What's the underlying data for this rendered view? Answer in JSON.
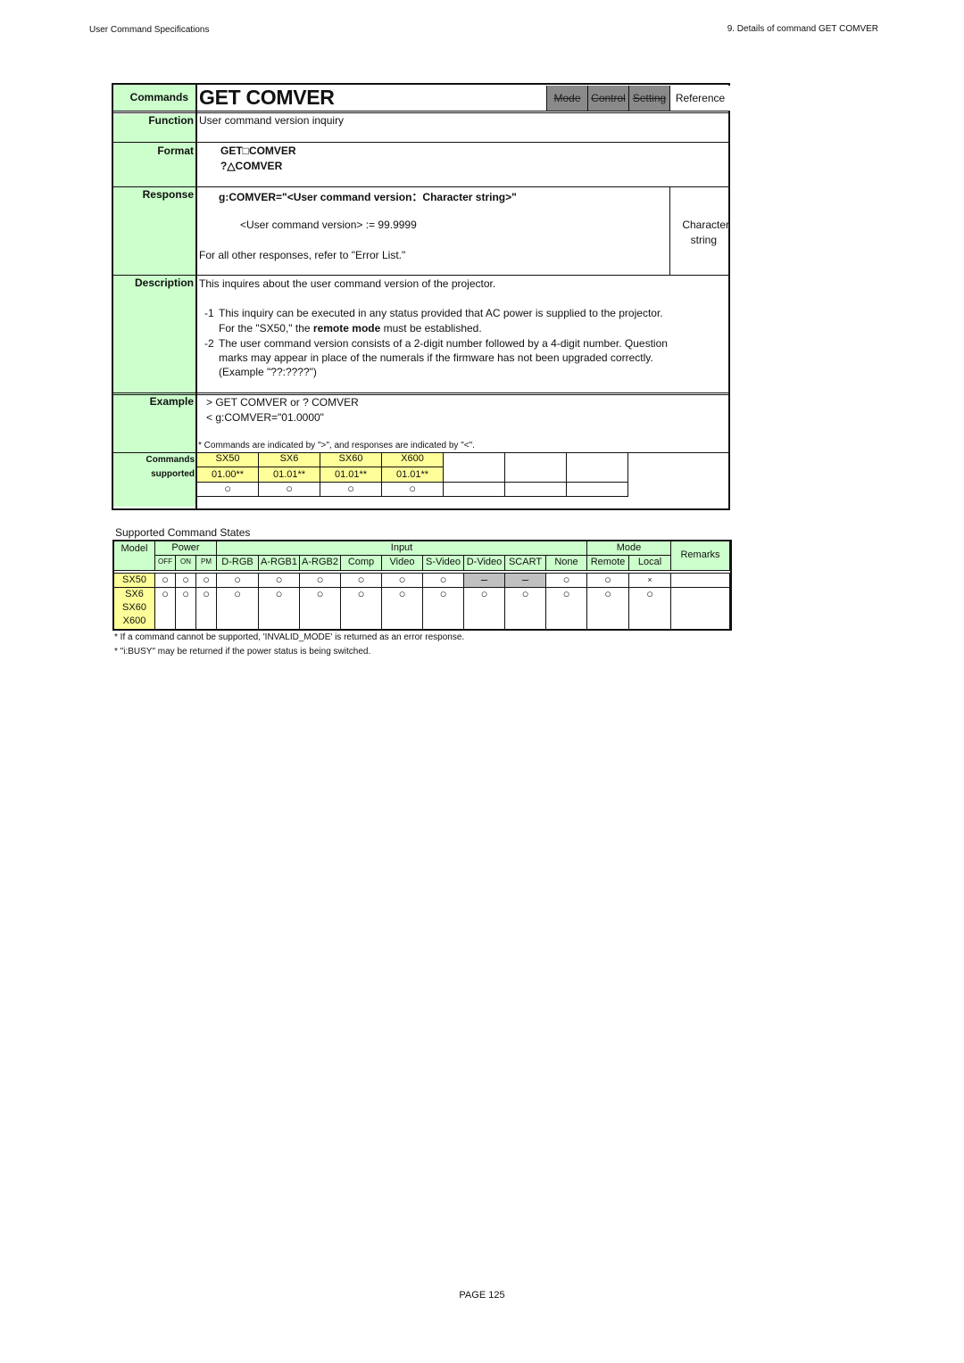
{
  "page_header": {
    "left": "User Command Specifications",
    "right": "9. Details of command  GET COMVER"
  },
  "spec": {
    "commands_label": "Commands",
    "command_name": "GET COMVER",
    "tabs": [
      {
        "label": "Mode",
        "enabled": false
      },
      {
        "label": "Control",
        "enabled": false
      },
      {
        "label": "Setting",
        "enabled": false
      },
      {
        "label": "Reference",
        "enabled": true
      }
    ],
    "function_label": "Function",
    "function_text": "User command version inquiry",
    "format_label": "Format",
    "format_lines": [
      "GET□COMVER",
      "?△COMVER"
    ],
    "response_label": "Response",
    "response_format": "g:COMVER=\"<User command version：Character string>\"",
    "response_def": "<User command version> := 99.9999",
    "response_type": [
      "Character",
      "string"
    ],
    "response_other": "For all other responses, refer to \"Error List.\"",
    "description_label": "Description",
    "description_intro": "This inquires about the user command version of the projector.",
    "description_items": [
      {
        "num": "-1",
        "lines": [
          "This inquiry can be executed in any status provided that AC power is supplied to the projector.",
          "For the \"SX50,\" the ",
          "remote mode",
          " must be established."
        ]
      },
      {
        "num": "-2",
        "lines": [
          "The user command version consists of a 2-digit number followed by a 4-digit number. Question",
          "marks may appear in place of the numerals if the firmware has not been upgraded correctly.",
          "(Example \"??:????\")"
        ]
      }
    ],
    "example_label": "Example",
    "example_lines": [
      ">  GET COMVER or ? COMVER",
      "<  g:COMVER=\"01.0000\""
    ],
    "example_note": "* Commands are indicated by \">\", and responses are indicated by \"<\".",
    "supported_label": [
      "Commands",
      "supported"
    ],
    "supported_models": [
      {
        "model": "SX50",
        "version": "01.00**",
        "mark": "○"
      },
      {
        "model": "SX6",
        "version": "01.01**",
        "mark": "○"
      },
      {
        "model": "SX60",
        "version": "01.01**",
        "mark": "○"
      },
      {
        "model": "X600",
        "version": "01.01**",
        "mark": "○"
      }
    ]
  },
  "states": {
    "title": "Supported Command States",
    "headers": {
      "model": "Model",
      "power": "Power",
      "power_sub": [
        "OFF",
        "ON",
        "PM"
      ],
      "input": "Input",
      "input_sub": [
        "D-RGB",
        "A-RGB1",
        "A-RGB2",
        "Comp",
        "Video",
        "S-Video",
        "D-Video",
        "SCART",
        "None"
      ],
      "mode": "Mode",
      "mode_sub": [
        "Remote",
        "Local"
      ],
      "remarks": "Remarks"
    },
    "rows": [
      {
        "models": [
          "SX50"
        ],
        "values": [
          "○",
          "○",
          "○",
          "○",
          "○",
          "○",
          "○",
          "○",
          "○",
          "–",
          "–",
          "○",
          "○",
          "×"
        ],
        "remarks": ""
      },
      {
        "models": [
          "SX6",
          "SX60",
          "X600"
        ],
        "values": [
          "○",
          "○",
          "○",
          "○",
          "○",
          "○",
          "○",
          "○",
          "○",
          "○",
          "○",
          "○",
          "○",
          "○"
        ],
        "remarks": ""
      }
    ],
    "notes": [
      "* If a command cannot be supported, 'INVALID_MODE' is returned as an error response.",
      "* \"i:BUSY\" may be returned if the power status is being switched."
    ]
  },
  "page_number": "PAGE 125"
}
